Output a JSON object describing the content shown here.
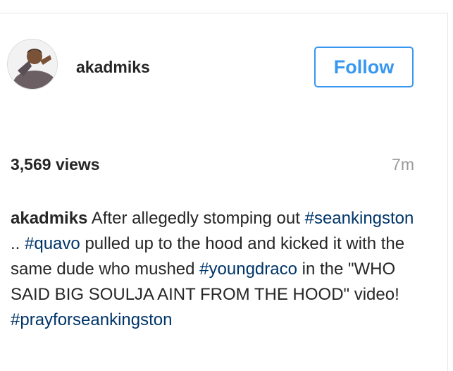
{
  "post": {
    "username": "akadmiks",
    "follow_label": "Follow",
    "views": "3,569 views",
    "time_ago": "7m"
  },
  "caption": {
    "author": "akadmiks",
    "t1": "After allegedly stomping out",
    "tag1": "#seankingston",
    "t2": "..",
    "tag2": "#quavo",
    "t3": "pulled up to the hood and kicked it with the same dude who mushed",
    "tag3": "#youngdraco",
    "t4": "in the \"WHO SAID BIG SOULJA AINT FROM THE HOOD\" video!",
    "tag4": "#prayforseankingston"
  },
  "colors": {
    "accent": "#3897f0",
    "hashtag": "#003569",
    "muted": "#999999",
    "text": "#262626"
  }
}
